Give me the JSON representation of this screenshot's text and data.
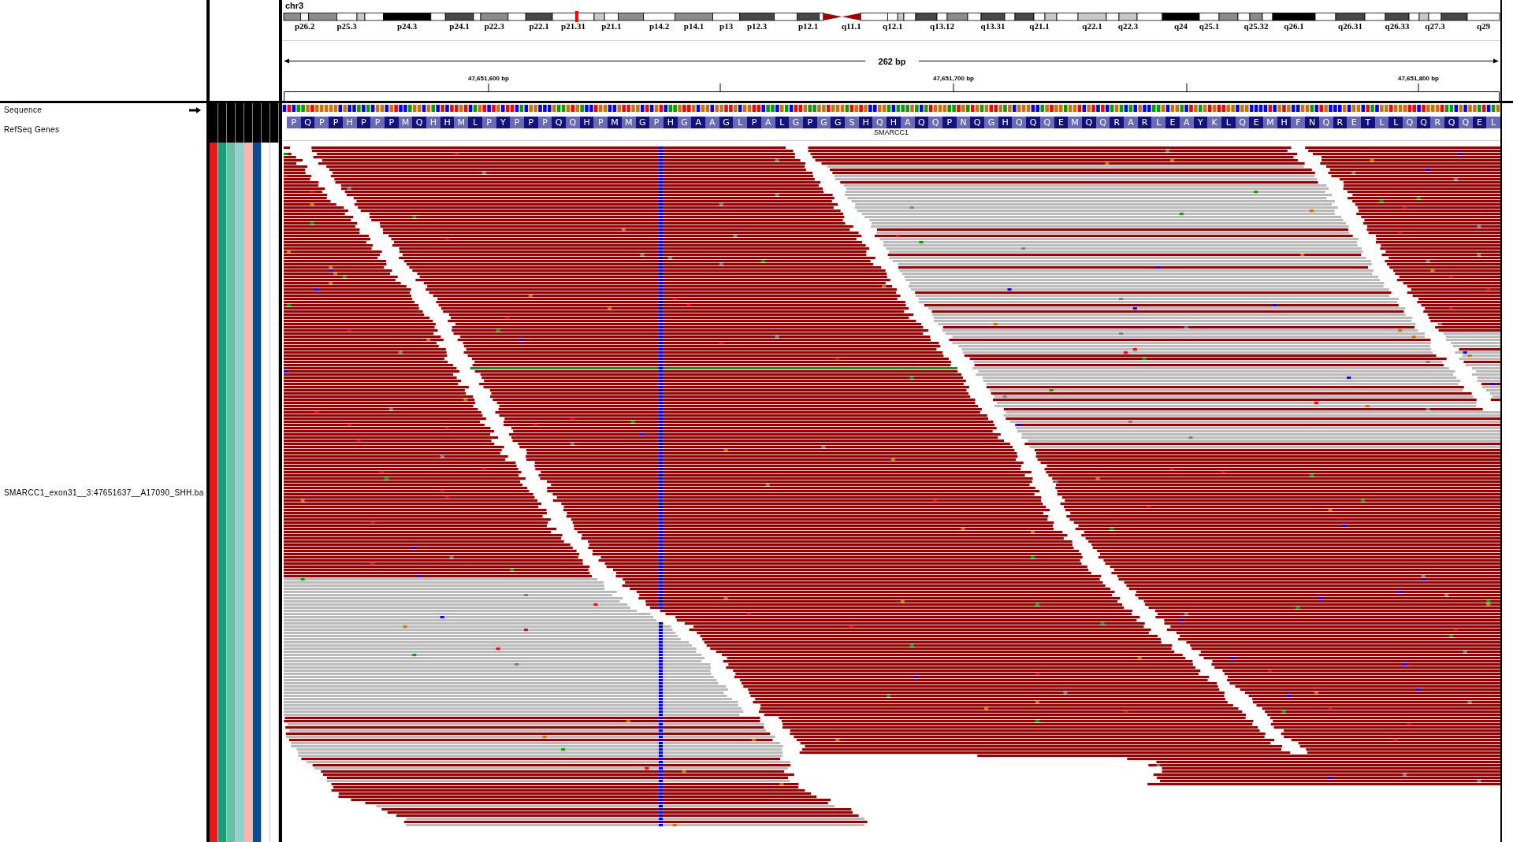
{
  "chromosome": {
    "name": "chr3",
    "bands": [
      {
        "kind": "gpos50"
      },
      {
        "kind": "gneg",
        "label": "p26.2"
      },
      {
        "kind": "gpos50"
      },
      {
        "kind": "gneg",
        "label": "p25.3"
      },
      {
        "kind": "gpos25"
      },
      {
        "kind": "gneg"
      },
      {
        "kind": "gpos100",
        "label": "p24.3"
      },
      {
        "kind": "gneg"
      },
      {
        "kind": "gpos75",
        "label": "p24.1"
      },
      {
        "kind": "gneg"
      },
      {
        "kind": "gpos50",
        "label": "p22.3"
      },
      {
        "kind": "gneg"
      },
      {
        "kind": "gpos75",
        "label": "p22.1"
      },
      {
        "kind": "gneg",
        "label": "p21.31"
      },
      {
        "kind": "gpos25"
      },
      {
        "kind": "gneg",
        "label": "p21.1"
      },
      {
        "kind": "gpos50"
      },
      {
        "kind": "gneg",
        "label": "p14.2"
      },
      {
        "kind": "gpos50",
        "label": "p14.1"
      },
      {
        "kind": "gneg",
        "label": "p13"
      },
      {
        "kind": "gpos75",
        "label": "p12.3"
      },
      {
        "kind": "gneg"
      },
      {
        "kind": "gpos75",
        "label": "p12.1"
      },
      {
        "kind": "gneg"
      },
      {
        "kind": "acen"
      },
      {
        "kind": "acen",
        "label": "q11.1"
      },
      {
        "kind": "gneg"
      },
      {
        "kind": "gneg",
        "label": "q12.1"
      },
      {
        "kind": "gpos25"
      },
      {
        "kind": "gneg"
      },
      {
        "kind": "gpos75"
      },
      {
        "kind": "gneg",
        "label": "q13.12"
      },
      {
        "kind": "gpos50"
      },
      {
        "kind": "gneg"
      },
      {
        "kind": "gpos75",
        "label": "q13.31"
      },
      {
        "kind": "gneg"
      },
      {
        "kind": "gpos75"
      },
      {
        "kind": "gneg",
        "label": "q21.1"
      },
      {
        "kind": "gpos25"
      },
      {
        "kind": "gneg"
      },
      {
        "kind": "gpos25",
        "label": "q22.1"
      },
      {
        "kind": "gneg"
      },
      {
        "kind": "gpos25",
        "label": "q22.3"
      },
      {
        "kind": "gneg"
      },
      {
        "kind": "gpos100",
        "label": "q24"
      },
      {
        "kind": "gneg",
        "label": "q25.1"
      },
      {
        "kind": "gpos50"
      },
      {
        "kind": "gneg"
      },
      {
        "kind": "gpos50",
        "label": "q25.32"
      },
      {
        "kind": "gneg"
      },
      {
        "kind": "gpos100",
        "label": "q26.1"
      },
      {
        "kind": "gneg"
      },
      {
        "kind": "gpos75",
        "label": "q26.31"
      },
      {
        "kind": "gneg"
      },
      {
        "kind": "gpos75",
        "label": "q26.33"
      },
      {
        "kind": "gneg"
      },
      {
        "kind": "gpos25"
      },
      {
        "kind": "gneg",
        "label": "q27.3"
      },
      {
        "kind": "gpos75"
      },
      {
        "kind": "gneg",
        "label": "q29"
      }
    ]
  },
  "ruler": {
    "span": "262 bp",
    "tick_labels": [
      "47,651,600 bp",
      "47,651,700 bp",
      "47,651,800 bp"
    ]
  },
  "tracks": [
    {
      "kind": "sequence",
      "name": "Sequence"
    },
    {
      "kind": "gene",
      "name": "RefSeq Genes",
      "gene": "SMARCC1",
      "amino_acids": [
        "P",
        "Q",
        "P",
        "P",
        "H",
        "P",
        "P",
        "P",
        "M",
        "Q",
        "H",
        "H",
        "M",
        "L",
        "P",
        "Y",
        "P",
        "P",
        "P",
        "Q",
        "Q",
        "H",
        "P",
        "M",
        "M",
        "G",
        "P",
        "H",
        "G",
        "A",
        "A",
        "G",
        "L",
        "P",
        "A",
        "L",
        "G",
        "P",
        "G",
        "G",
        "S",
        "H",
        "Q",
        "H",
        "A",
        "Q",
        "Q",
        "P",
        "N",
        "Q",
        "G",
        "H",
        "Q",
        "Q",
        "Q",
        "E",
        "M",
        "Q",
        "Q",
        "R",
        "A",
        "R",
        "L",
        "E",
        "A",
        "Y",
        "K",
        "L",
        "Q",
        "E",
        "M",
        "H",
        "F",
        "N",
        "Q",
        "R",
        "E",
        "T",
        "L",
        "L",
        "Q",
        "Q",
        "R",
        "Q",
        "Q",
        "E",
        "L"
      ]
    },
    {
      "kind": "alignment",
      "name": "SMARCC1_exon31__3:47651637__A17090_SHH.ba",
      "attributes": [
        {
          "color": "#e41a1c"
        },
        {
          "color": "#1b9e77"
        },
        {
          "color": "#66c2a5"
        },
        {
          "color": "#8dd3c7"
        },
        {
          "color": "#fbb4ae"
        },
        {
          "color": "#0c4a92"
        }
      ]
    }
  ]
}
